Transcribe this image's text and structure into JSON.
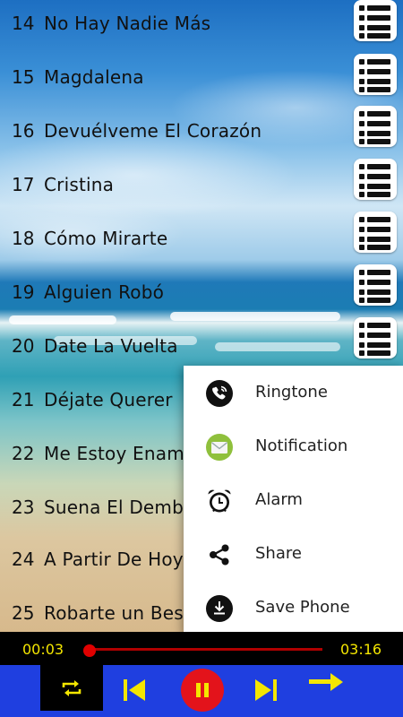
{
  "songs": [
    {
      "num": "14",
      "title": "No Hay Nadie Más"
    },
    {
      "num": "15",
      "title": "Magdalena"
    },
    {
      "num": "16",
      "title": "Devuélveme El Corazón"
    },
    {
      "num": "17",
      "title": "Cristina"
    },
    {
      "num": "18",
      "title": "Cómo Mirarte"
    },
    {
      "num": "19",
      "title": "Alguien Robó"
    },
    {
      "num": "20",
      "title": "Date La Vuelta"
    },
    {
      "num": "21",
      "title": "Déjate Querer"
    },
    {
      "num": "22",
      "title": "Me Estoy Enam"
    },
    {
      "num": "23",
      "title": "Suena El Dembo"
    },
    {
      "num": "24",
      "title": "A Partir De Hoy"
    },
    {
      "num": "25",
      "title": "Robarte un Bese"
    }
  ],
  "popup_menu": {
    "items": [
      {
        "label": "Ringtone",
        "icon": "phone-ringtone-icon"
      },
      {
        "label": "Notification",
        "icon": "envelope-icon"
      },
      {
        "label": "Alarm",
        "icon": "alarm-clock-icon"
      },
      {
        "label": "Share",
        "icon": "share-icon"
      },
      {
        "label": "Save Phone",
        "icon": "download-icon"
      }
    ]
  },
  "player": {
    "current_time": "00:03",
    "total_time": "03:16",
    "progress_fraction": 0.015
  },
  "colors": {
    "time_text": "#f4e600",
    "control_bar": "#1f3fe0",
    "control_icons": "#f4e600",
    "pause_button": "#e3131b",
    "progress_track": "#b00000"
  }
}
